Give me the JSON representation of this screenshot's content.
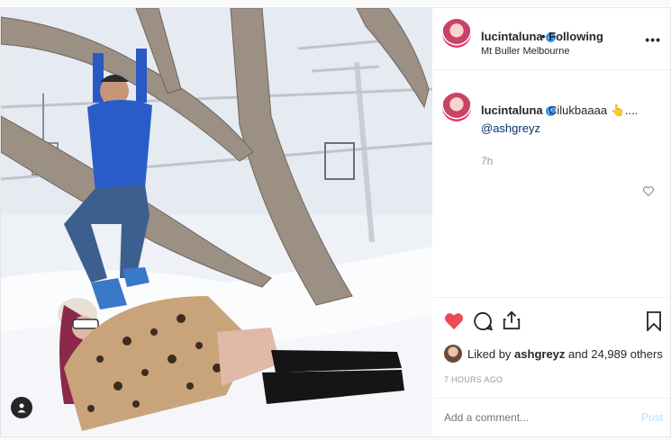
{
  "header": {
    "username": "lucintaluna",
    "verified_mark": "✓",
    "follow_status": "• Following",
    "location": "Mt Buller Melbourne",
    "more_label": "•••"
  },
  "caption": {
    "username": "lucintaluna",
    "text": "Cilukbaaaa 👆....",
    "mention": "@ashgreyz",
    "time": "7h"
  },
  "actions": {
    "liked_by_prefix": "Liked by ",
    "liked_by_user": "ashgreyz",
    "likes_suffix": " and 24,989 others",
    "time_ago": "7 HOURS AGO"
  },
  "comment": {
    "placeholder": "Add a comment...",
    "post_label": "Post"
  },
  "icons": {
    "like": "heart-filled-icon",
    "comment": "comment-bubble-icon",
    "share": "share-icon",
    "save": "bookmark-icon",
    "small_like": "heart-outline-icon",
    "tags": "user-tag-icon",
    "options": "more-options-icon"
  },
  "colors": {
    "like_red": "#ed4956",
    "verified_blue": "#3897f0",
    "post_button": "#b2dffc",
    "mention_blue": "#003569"
  }
}
